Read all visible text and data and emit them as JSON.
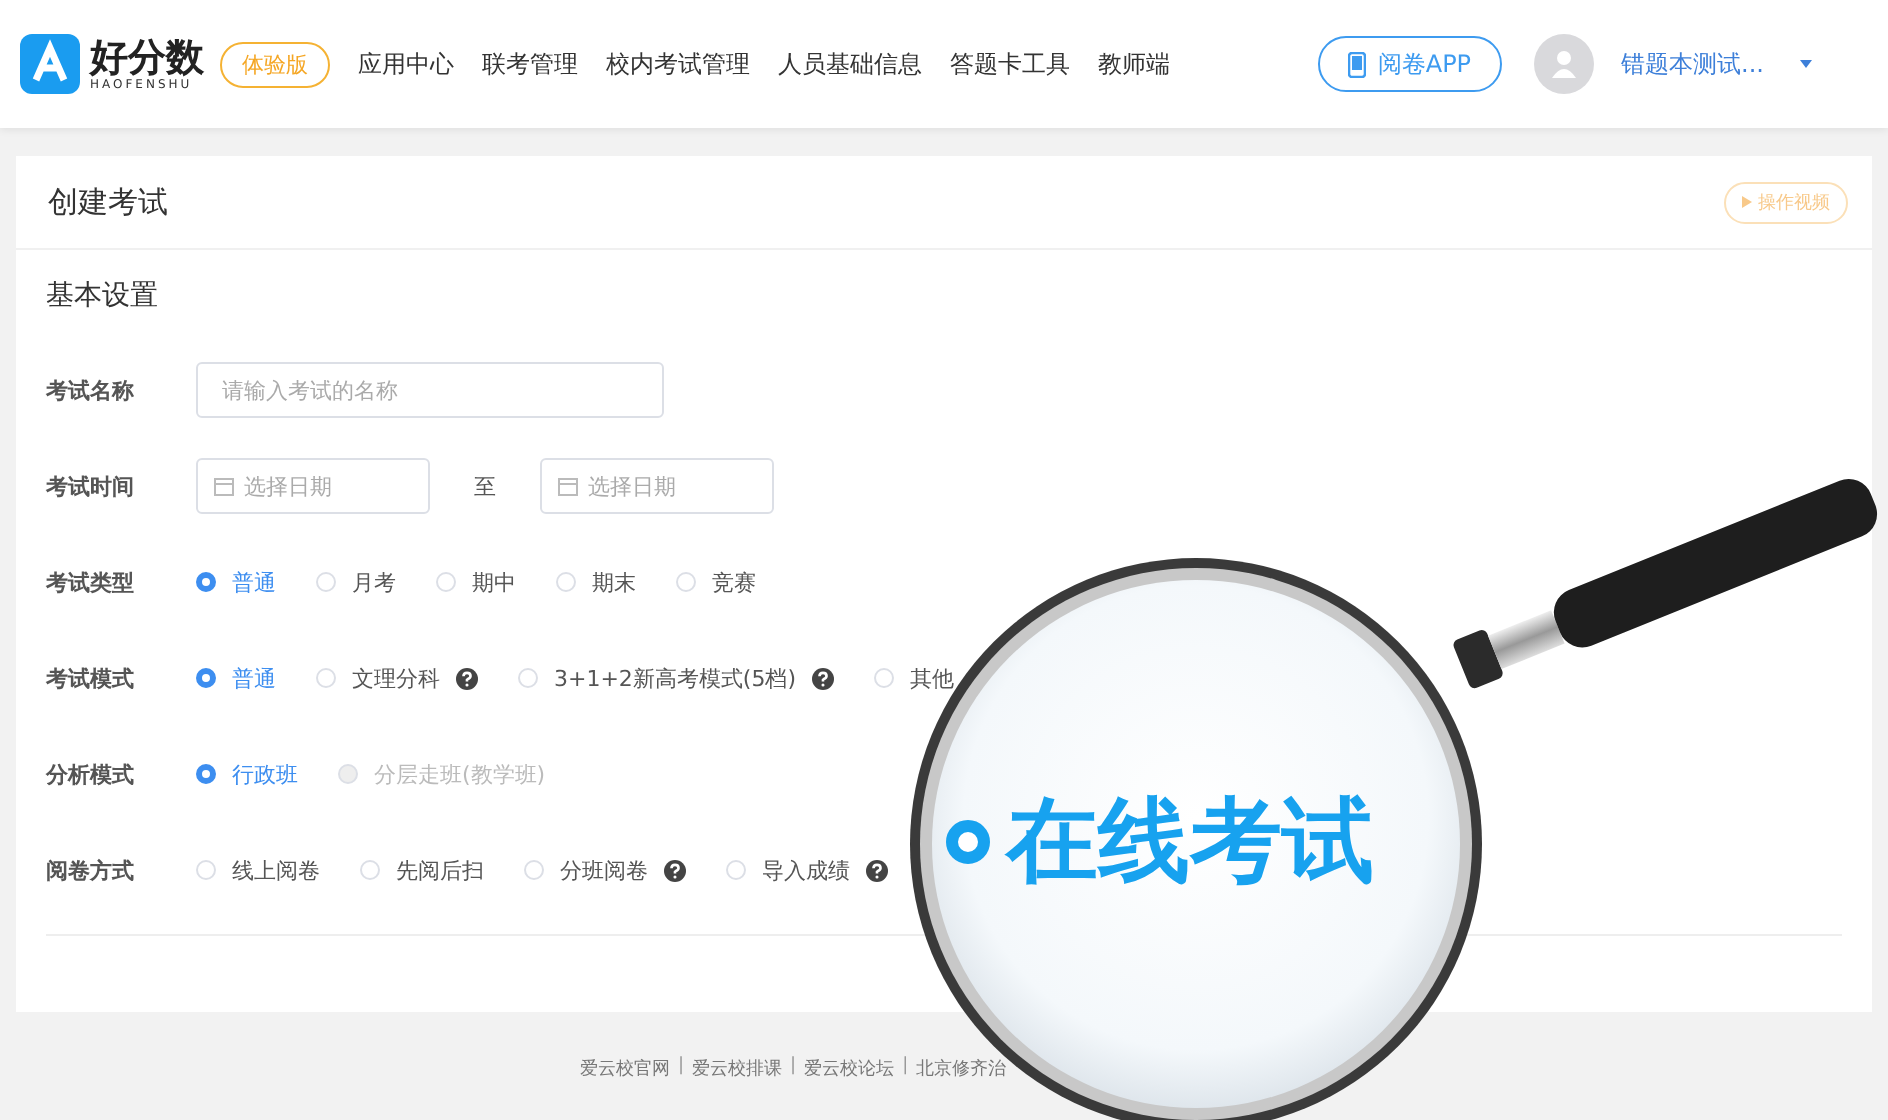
{
  "header": {
    "logo": {
      "name": "好分数",
      "sub": "HAOFENSHU"
    },
    "badge": "体验版",
    "nav": [
      "应用中心",
      "联考管理",
      "校内考试管理",
      "人员基础信息",
      "答题卡工具",
      "教师端"
    ],
    "app_button": "阅卷APP",
    "user": "错题本测试..."
  },
  "card": {
    "title": "创建考试",
    "video_button": "操作视频",
    "section": "基本设置",
    "fields": [
      {
        "kind": "input",
        "label": "考试名称",
        "placeholder": "请输入考试的名称"
      },
      {
        "kind": "daterange",
        "label": "考试时间",
        "start_placeholder": "选择日期",
        "separator": "至",
        "end_placeholder": "选择日期"
      },
      {
        "kind": "radio",
        "label": "考试类型",
        "options": [
          {
            "label": "普通",
            "selected": true,
            "help": false,
            "disabled": false
          },
          {
            "label": "月考",
            "selected": false,
            "help": false,
            "disabled": false
          },
          {
            "label": "期中",
            "selected": false,
            "help": false,
            "disabled": false
          },
          {
            "label": "期末",
            "selected": false,
            "help": false,
            "disabled": false
          },
          {
            "label": "竞赛",
            "selected": false,
            "help": false,
            "disabled": false
          }
        ]
      },
      {
        "kind": "radio",
        "label": "考试模式",
        "options": [
          {
            "label": "普通",
            "selected": true,
            "help": false,
            "disabled": false
          },
          {
            "label": "文理分科",
            "selected": false,
            "help": true,
            "disabled": false
          },
          {
            "label": "3+1+2新高考模式(5档)",
            "selected": false,
            "help": true,
            "disabled": false
          },
          {
            "label": "其他",
            "selected": false,
            "help": false,
            "disabled": false
          }
        ]
      },
      {
        "kind": "radio",
        "label": "分析模式",
        "options": [
          {
            "label": "行政班",
            "selected": true,
            "help": false,
            "disabled": false
          },
          {
            "label": "分层走班(教学班)",
            "selected": false,
            "help": false,
            "disabled": true
          }
        ]
      },
      {
        "kind": "radio",
        "label": "阅卷方式",
        "options": [
          {
            "label": "线上阅卷",
            "selected": false,
            "help": false,
            "disabled": false
          },
          {
            "label": "先阅后扫",
            "selected": false,
            "help": false,
            "disabled": false
          },
          {
            "label": "分班阅卷",
            "selected": false,
            "help": true,
            "disabled": false
          },
          {
            "label": "导入成绩",
            "selected": false,
            "help": true,
            "disabled": false
          }
        ]
      }
    ]
  },
  "footer": [
    {
      "kind": "link",
      "text": "爱云校官网"
    },
    {
      "kind": "separator",
      "text": "|"
    },
    {
      "kind": "link",
      "text": "爱云校排课"
    },
    {
      "kind": "separator",
      "text": "|"
    },
    {
      "kind": "link",
      "text": "爱云校论坛"
    },
    {
      "kind": "separator",
      "text": "|"
    },
    {
      "kind": "link",
      "text": "北京修齐治"
    }
  ],
  "magnifier": {
    "text": "在线考试",
    "selected": true
  }
}
